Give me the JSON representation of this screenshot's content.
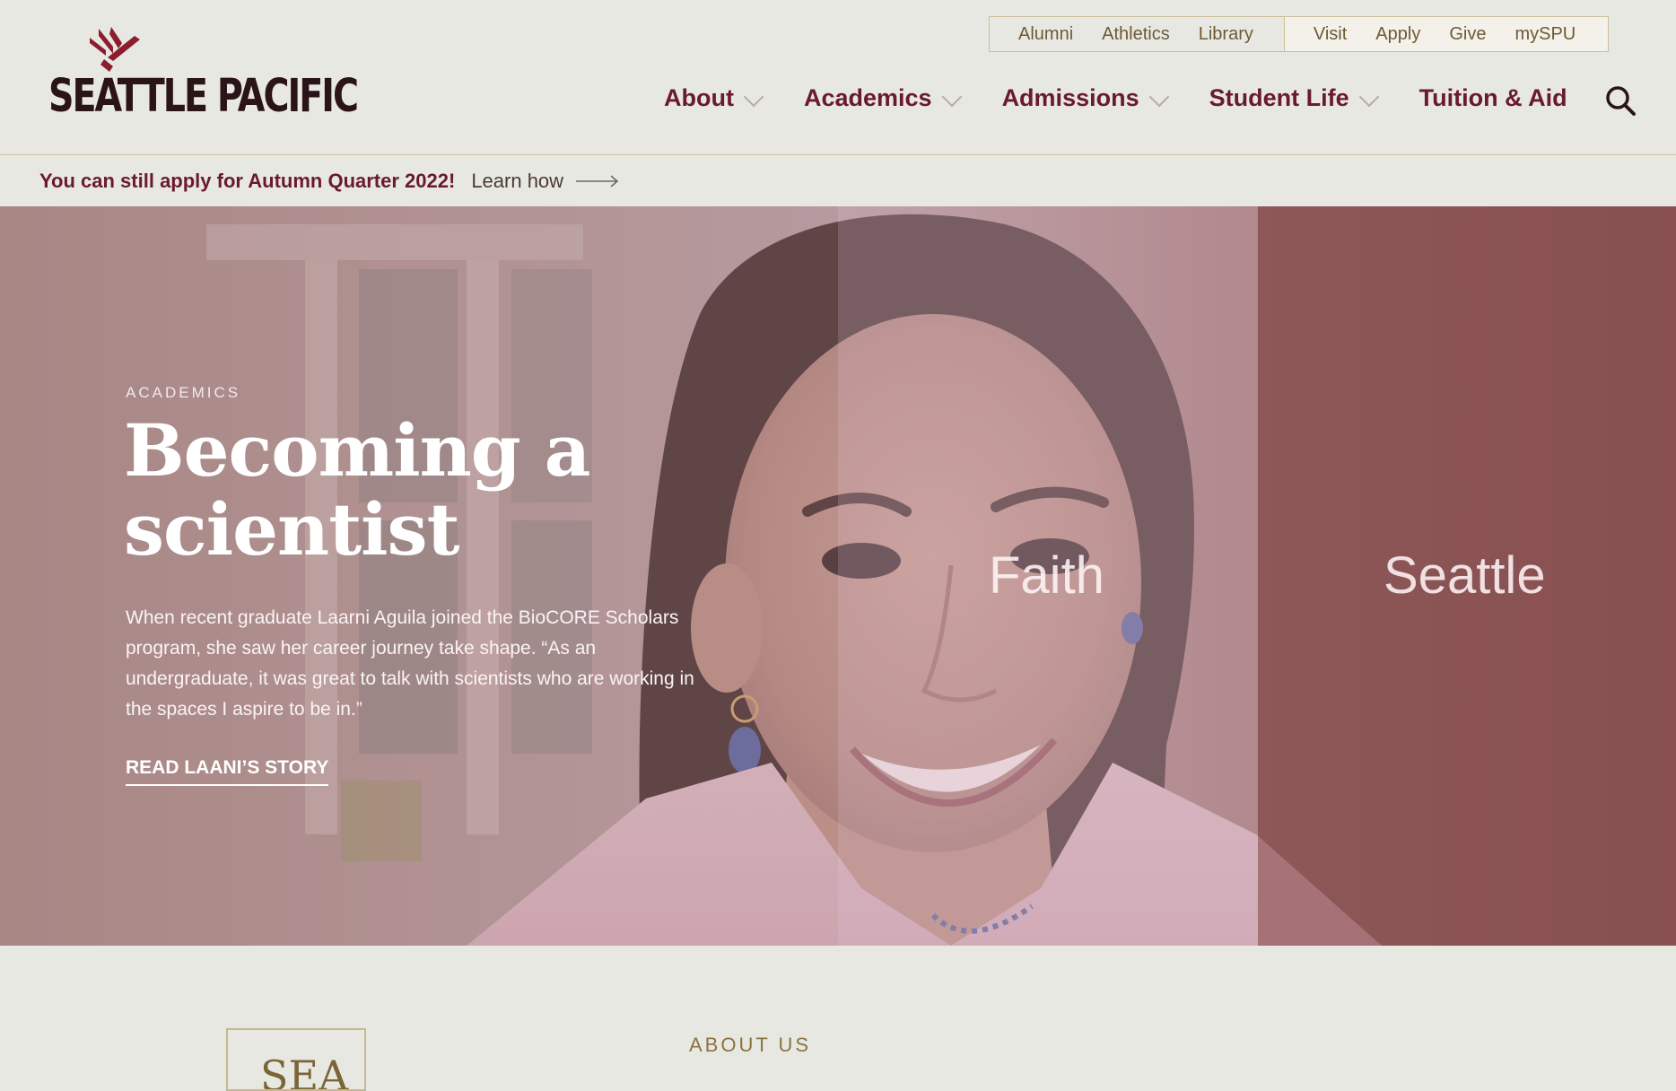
{
  "logo": {
    "text": "SEATTLE PACIFIC",
    "brand_color": "#8c1d2e"
  },
  "utility_nav": {
    "left": [
      "Alumni",
      "Athletics",
      "Library"
    ],
    "right": [
      "Visit",
      "Apply",
      "Give",
      "mySPU"
    ]
  },
  "main_nav": {
    "items": [
      {
        "label": "About",
        "has_dropdown": true
      },
      {
        "label": "Academics",
        "has_dropdown": true
      },
      {
        "label": "Admissions",
        "has_dropdown": true
      },
      {
        "label": "Student Life",
        "has_dropdown": true
      },
      {
        "label": "Tuition & Aid",
        "has_dropdown": false
      }
    ],
    "search_icon": "search-icon"
  },
  "alert": {
    "message": "You can still apply for Autumn Quarter 2022!",
    "link": "Learn how",
    "icon": "arrow-right-icon"
  },
  "hero": {
    "eyebrow": "ACADEMICS",
    "title": "Becoming a scientist",
    "description": "When recent graduate Laarni Aguila joined the BioCORE Scholars program, she saw her career journey take shape. “As an undergraduate, it was great to talk with scientists who are working in the spaces I aspire to be in.”",
    "cta": "READ LAANI’S STORY",
    "panels": [
      "Faith",
      "Seattle"
    ]
  },
  "below": {
    "sea_text": "SEA",
    "about_label": "ABOUT US"
  },
  "colors": {
    "primary": "#6a1a2e",
    "background": "#e8e8e3",
    "gold": "#cbbf9a"
  }
}
